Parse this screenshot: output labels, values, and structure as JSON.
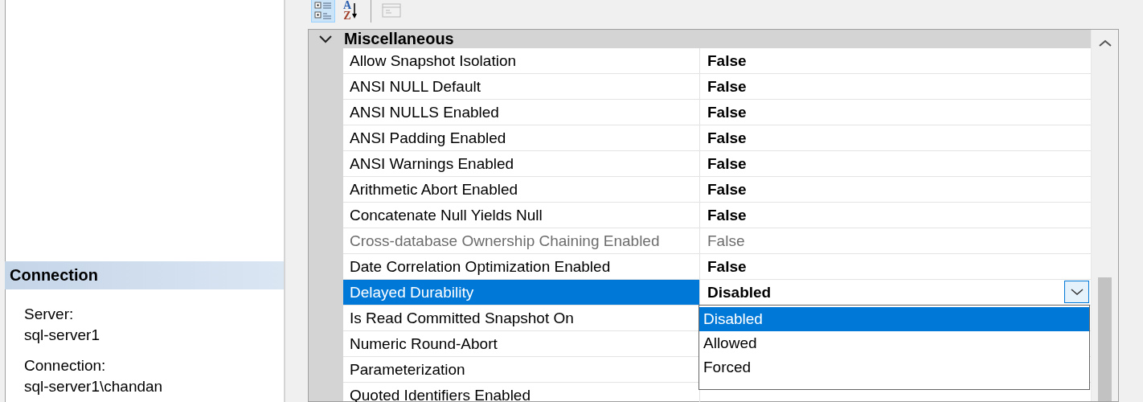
{
  "connection": {
    "title": "Connection",
    "fields": [
      {
        "label": "Server:",
        "value": "sql-server1"
      },
      {
        "label": "Connection:",
        "value": "sql-server1\\chandan"
      }
    ]
  },
  "toolbar": [
    {
      "kind": "categorized",
      "selected": true
    },
    {
      "kind": "alphabetical",
      "letters": [
        "A",
        "Z"
      ],
      "selected": false
    },
    {
      "kind": "separator"
    },
    {
      "kind": "pages",
      "disabled": true
    }
  ],
  "categories": [
    {
      "title": "Miscellaneous",
      "expanded": true,
      "properties": [
        {
          "name": "Allow Snapshot Isolation",
          "value": "False",
          "disabled": false,
          "selected": false
        },
        {
          "name": "ANSI NULL Default",
          "value": "False",
          "disabled": false,
          "selected": false
        },
        {
          "name": "ANSI NULLS Enabled",
          "value": "False",
          "disabled": false,
          "selected": false
        },
        {
          "name": "ANSI Padding Enabled",
          "value": "False",
          "disabled": false,
          "selected": false
        },
        {
          "name": "ANSI Warnings Enabled",
          "value": "False",
          "disabled": false,
          "selected": false
        },
        {
          "name": "Arithmetic Abort Enabled",
          "value": "False",
          "disabled": false,
          "selected": false
        },
        {
          "name": "Concatenate Null Yields Null",
          "value": "False",
          "disabled": false,
          "selected": false
        },
        {
          "name": "Cross-database Ownership Chaining Enabled",
          "value": "False",
          "disabled": true,
          "selected": false
        },
        {
          "name": "Date Correlation Optimization Enabled",
          "value": "False",
          "disabled": false,
          "selected": false
        },
        {
          "name": "Delayed Durability",
          "value": "Disabled",
          "disabled": false,
          "selected": true,
          "dropdown": {
            "options": [
              {
                "label": "Disabled",
                "selected": true
              },
              {
                "label": "Allowed",
                "selected": false
              },
              {
                "label": "Forced",
                "selected": false
              }
            ]
          }
        },
        {
          "name": "Is Read Committed Snapshot On",
          "disabled": false,
          "selected": false
        },
        {
          "name": "Numeric Round-Abort",
          "disabled": false,
          "selected": false
        },
        {
          "name": "Parameterization",
          "disabled": false,
          "selected": false
        },
        {
          "name": "Quoted Identifiers Enabled",
          "disabled": false,
          "selected": false
        }
      ]
    }
  ]
}
